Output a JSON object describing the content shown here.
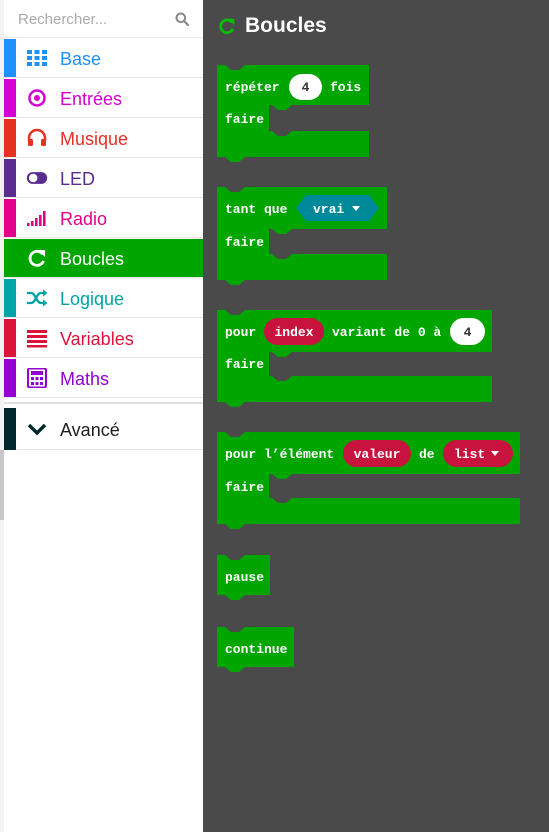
{
  "search": {
    "placeholder": "Rechercher..."
  },
  "categories": [
    {
      "label": "Base",
      "color": "#1e90ff",
      "icon": "grid-icon"
    },
    {
      "label": "Entrées",
      "color": "#d400d4",
      "icon": "target-icon"
    },
    {
      "label": "Musique",
      "color": "#e63022",
      "icon": "headphones-icon"
    },
    {
      "label": "LED",
      "color": "#5c2d91",
      "icon": "toggle-icon"
    },
    {
      "label": "Radio",
      "color": "#e3008c",
      "icon": "signal-bars-icon"
    },
    {
      "label": "Boucles",
      "color": "#00a500",
      "icon": "refresh-icon",
      "active": true
    },
    {
      "label": "Logique",
      "color": "#00a4a6",
      "icon": "shuffle-icon"
    },
    {
      "label": "Variables",
      "color": "#dc143c",
      "icon": "list-lines-icon"
    },
    {
      "label": "Maths",
      "color": "#9400d3",
      "icon": "calculator-icon"
    }
  ],
  "advanced": {
    "label": "Avancé",
    "color": "#00272b",
    "icon": "chevron-down-icon"
  },
  "workspace": {
    "title": "Boucles",
    "block_color": "#00a500",
    "blocks": {
      "repeat": {
        "word": "répéter",
        "count": "4",
        "unit": "fois",
        "do": "faire"
      },
      "while": {
        "word": "tant que",
        "condition": "vrai",
        "do": "faire"
      },
      "for_index": {
        "word": "pour",
        "variable": "index",
        "middle": "variant de 0 à",
        "limit": "4",
        "do": "faire"
      },
      "for_each": {
        "word": "pour l’élément",
        "variable": "valeur",
        "of": "de",
        "list": "list",
        "do": "faire"
      },
      "pause": {
        "label": "pause"
      },
      "continue": {
        "label": "continue"
      }
    }
  }
}
